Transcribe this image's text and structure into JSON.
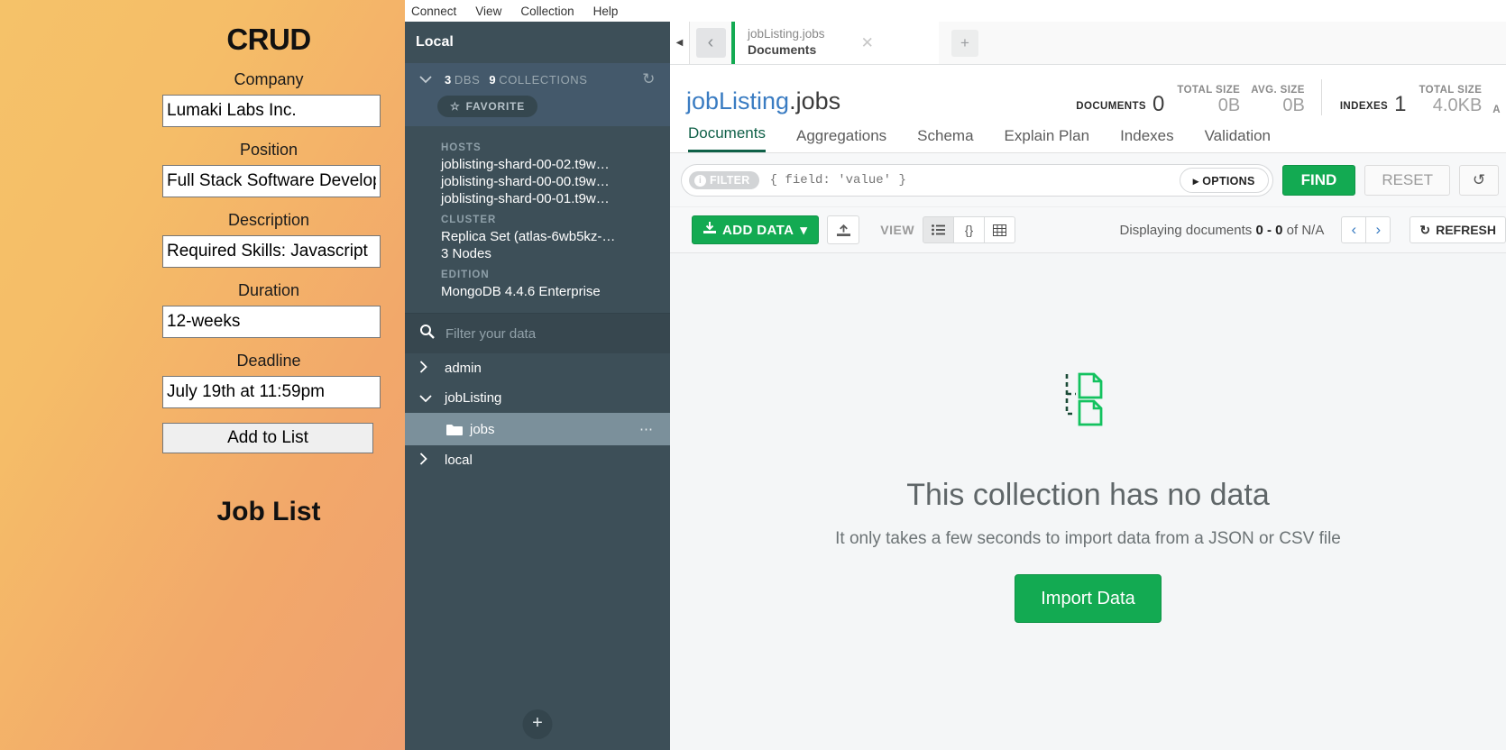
{
  "crud_app": {
    "title": "CRUD",
    "list_title": "Job List",
    "fields": [
      {
        "label": "Company",
        "value": "Lumaki Labs Inc.",
        "name": "company"
      },
      {
        "label": "Position",
        "value": "Full Stack Software Developer",
        "name": "position"
      },
      {
        "label": "Description",
        "value": "Required Skills: Javascript",
        "name": "description"
      },
      {
        "label": "Duration",
        "value": "12-weeks",
        "name": "duration"
      },
      {
        "label": "Deadline",
        "value": "July 19th at 11:59pm",
        "name": "deadline"
      }
    ],
    "submit_label": "Add to List",
    "accent": "#f3b268"
  },
  "compass": {
    "menubar": [
      "Connect",
      "View",
      "Collection",
      "Help"
    ],
    "sidebar": {
      "connection_name": "Local",
      "db_count": "3",
      "db_count_label": "DBS",
      "collection_count": "9",
      "collection_count_label": "COLLECTIONS",
      "refresh_icon": "refresh-icon",
      "favorite_label": "FAVORITE",
      "favorite_icon": "star-icon",
      "hosts_label": "HOSTS",
      "hosts": [
        "joblisting-shard-00-02.t9w…",
        "joblisting-shard-00-00.t9w…",
        "joblisting-shard-00-01.t9w…"
      ],
      "cluster_label": "CLUSTER",
      "cluster_lines": [
        "Replica Set (atlas-6wb5kz-…",
        "3 Nodes"
      ],
      "edition_label": "EDITION",
      "edition": "MongoDB 4.4.6 Enterprise",
      "filter_placeholder": "Filter your data",
      "filter_value": "",
      "search_icon": "search-icon",
      "databases": [
        {
          "name": "admin",
          "expanded": false,
          "collections": []
        },
        {
          "name": "jobListing",
          "expanded": true,
          "collections": [
            {
              "name": "jobs",
              "selected": true
            }
          ]
        },
        {
          "name": "local",
          "expanded": false,
          "collections": []
        }
      ],
      "add_button_label": "+"
    },
    "tabbar": {
      "collapse_icon": "collapse-left-icon",
      "back_icon": "chevron-left-icon",
      "tab": {
        "namespace": "jobListing.jobs",
        "view": "Documents",
        "close_icon": "close-icon"
      },
      "new_tab_label": "+"
    },
    "header": {
      "namespace_db": "jobListing",
      "namespace_coll": ".jobs",
      "stats": [
        {
          "label": "DOCUMENTS",
          "value": "0",
          "sub": [
            {
              "label": "TOTAL SIZE",
              "value": "0B"
            },
            {
              "label": "AVG. SIZE",
              "value": "0B"
            }
          ]
        },
        {
          "label": "INDEXES",
          "value": "1",
          "sub": [
            {
              "label": "TOTAL SIZE",
              "value": "4.0KB"
            },
            {
              "label": "AVG. SIZE",
              "value": ""
            }
          ]
        }
      ]
    },
    "nav_tabs": [
      {
        "label": "Documents",
        "active": true
      },
      {
        "label": "Aggregations",
        "active": false
      },
      {
        "label": "Schema",
        "active": false
      },
      {
        "label": "Explain Plan",
        "active": false
      },
      {
        "label": "Indexes",
        "active": false
      },
      {
        "label": "Validation",
        "active": false
      }
    ],
    "querybar": {
      "filter_pill": "FILTER",
      "filter_pill_icon": "info-icon",
      "query_placeholder": "{ field: 'value' }",
      "query_value": "",
      "options_label": "OPTIONS",
      "options_icon": "caret-right-icon",
      "find_label": "FIND",
      "reset_label": "RESET",
      "history_icon": "history-icon"
    },
    "toolbar": {
      "add_data_label": "ADD DATA",
      "add_data_icon": "download-icon",
      "add_data_caret": "caret-down-icon",
      "export_icon": "export-icon",
      "view_label": "VIEW",
      "views": [
        {
          "icon": "list-view-icon",
          "active": true
        },
        {
          "icon": "json-view-icon",
          "active": false
        },
        {
          "icon": "table-view-icon",
          "active": false
        }
      ],
      "displaying_prefix": "Displaying documents",
      "displaying_range": "0 - 0",
      "displaying_of": "of",
      "displaying_total": "N/A",
      "prev_icon": "chevron-left-icon",
      "next_icon": "chevron-right-icon",
      "refresh_label": "REFRESH",
      "refresh_icon": "refresh-icon"
    },
    "empty_state": {
      "icon": "empty-documents-icon",
      "title": "This collection has no data",
      "subtitle": "It only takes a few seconds to import data from a JSON or CSV file",
      "button_label": "Import Data"
    },
    "colors": {
      "green": "#13aa52",
      "sidebar": "#3d4f58",
      "link_blue": "#3a7cc2"
    }
  }
}
